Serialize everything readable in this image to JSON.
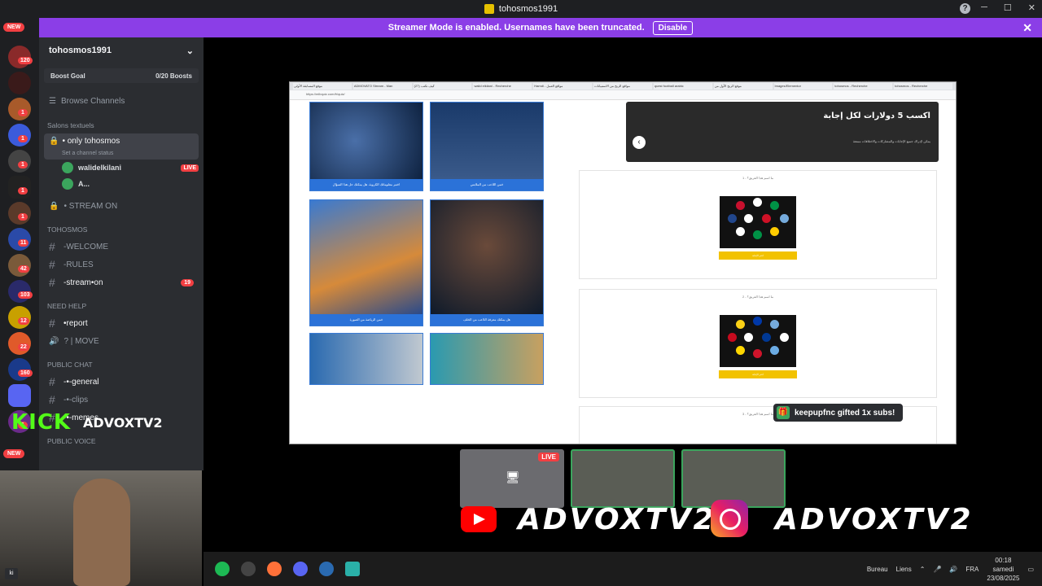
{
  "window": {
    "title": "tohosmos1991"
  },
  "banner": {
    "text": "Streamer Mode is enabled. Usernames have been truncated.",
    "disable_label": "Disable"
  },
  "servers": {
    "badges": [
      "NEW",
      "120",
      "1",
      "1",
      "1",
      "1",
      "1",
      "1",
      "11",
      "42",
      "103",
      "12",
      "22",
      "160",
      "1",
      "NEW"
    ]
  },
  "sidebar": {
    "guild_name": "tohosmos1991",
    "boost_goal": "Boost Goal",
    "boost_count": "0/20 Boosts",
    "browse_channels": "Browse Channels",
    "categories": {
      "text": "Salons textuels",
      "tohosmos": "TOHOSMOS",
      "need_help": "NEED HELP",
      "public_chat": "PUBLIC CHAT",
      "public_voice": "PUBLIC VOICE"
    },
    "voice_channel": {
      "name": "• only tohosmos",
      "status": "Set a channel status"
    },
    "voice_users": [
      {
        "name": "walidelkilani",
        "live": "LIVE"
      },
      {
        "name": "A..."
      }
    ],
    "stream_on": "• STREAM ON",
    "channels": {
      "welcome": "-WELCOME",
      "rules": "-RULES",
      "streamon": "-stream•on",
      "streamon_badge": "19",
      "report": "•report",
      "move": "? | MOVE",
      "general": "-•-general",
      "clips": "-•-clips",
      "memes": "-•-memes"
    }
  },
  "browser": {
    "tabs": [
      "موقع المسابقة الأولى",
      "ADMOVATO Stream - Man",
      "(27) كيف تكتب",
      "walid elkilani - Recherche",
      "Hamdi - مواقع العمل",
      "مواقع الربح من الاستبيانات",
      "quest football arabic",
      "موقع الربح الأول من",
      "Images/Elementor",
      "tohosmos - Recherche",
      "tohosmos - Recherche"
    ],
    "url": "https://mlbquiz.com/fr/quiz/",
    "hero_title": "اكسب 5 دولارات لكل إجابة",
    "hero_sub": "يمكن لإدراك جميع الإجابات والمشاركات والاختلافات ممتعة",
    "quiz_captions": [
      "اختبر معلوماتك الكروية، هل يمكنك حل هذا السؤال",
      "خمن اللاعب من الملابس",
      "خمن الرياضة من الصورة",
      "هل يمكنك معرفة اللاعب من الخلف",
      "",
      ""
    ],
    "questions": [
      {
        "text": "1 - ما اسم هذا الفريق؟",
        "button": "اختر الإجابة"
      },
      {
        "text": "2 - ما اسم هذا الفريق؟",
        "button": "اختر الإجابة"
      },
      {
        "text": "3 - ما اسم هذا الفريق؟"
      }
    ]
  },
  "toast": {
    "text": "keepupfnc gifted 1x subs!"
  },
  "stream": {
    "live_label": "LIVE",
    "kick_logo": "KICK",
    "kick_name": "ADVOXTV2",
    "youtube_name": "ADVOXTV2",
    "instagram_name": "ADVOXTV2"
  },
  "taskbar": {
    "desktop_label": "Bureau",
    "links_label": "Liens",
    "lang": "FRA",
    "time": "00:18",
    "day": "samedi",
    "date": "23/08/2025"
  },
  "corner_button": "ki"
}
